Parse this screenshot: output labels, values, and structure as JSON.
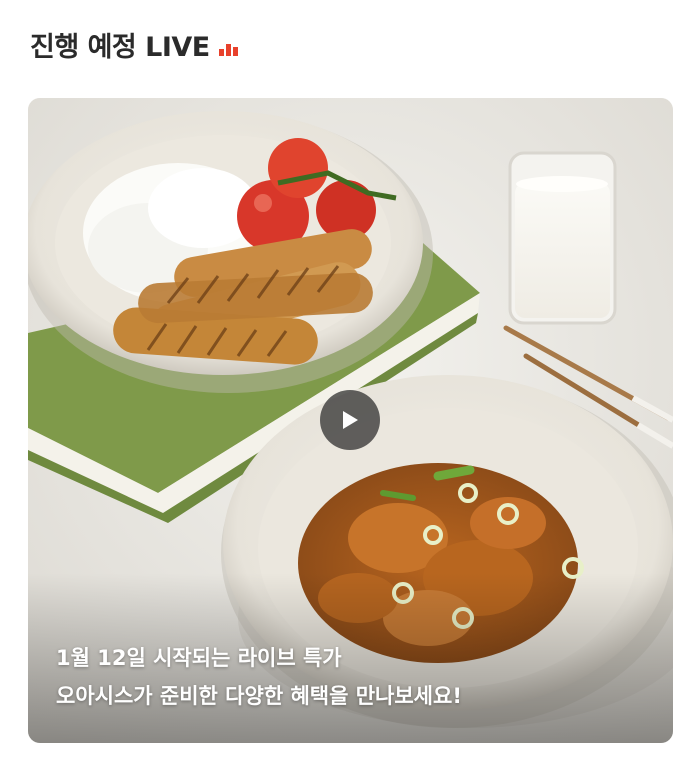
{
  "section": {
    "title": "진행 예정 LIVE",
    "title_icon": "live-bars-icon",
    "accent_color": "#e8412c"
  },
  "live_card": {
    "image": "thumbnail-photo",
    "play_icon": "play-icon",
    "caption_line1": "1월 12일 시작되는 라이브 특가",
    "caption_line2": "오아시스가 준비한 다양한 혜택을 만나보세요!"
  }
}
